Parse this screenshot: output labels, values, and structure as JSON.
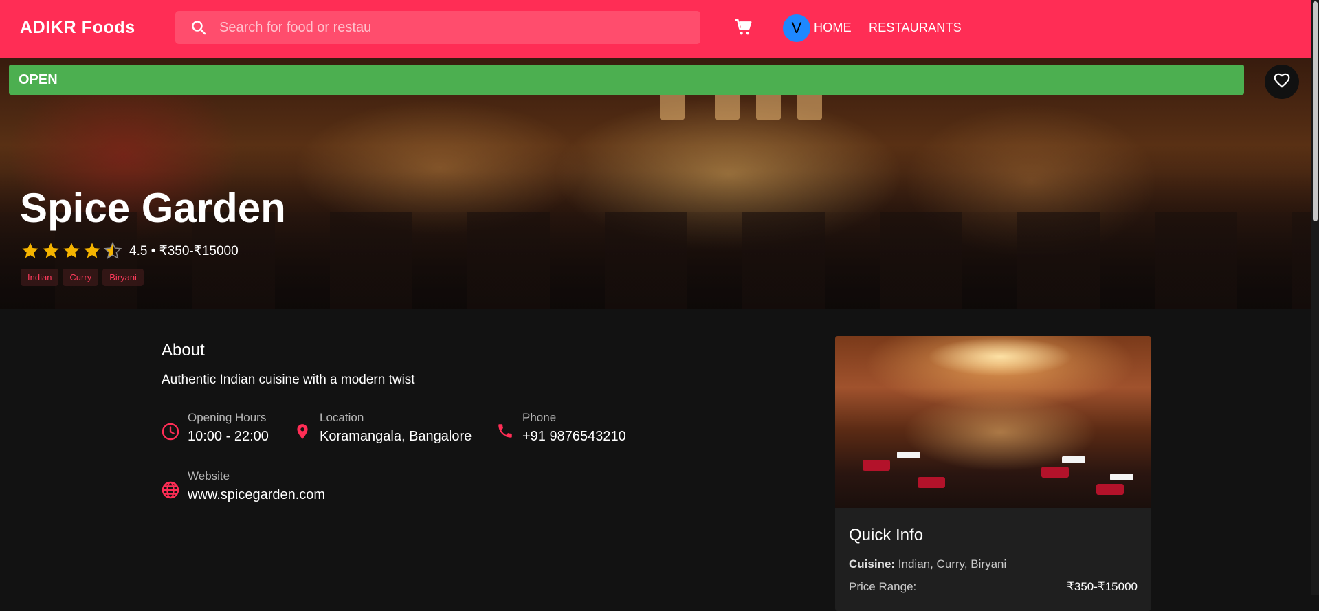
{
  "header": {
    "brand": "ADIKR Foods",
    "search_placeholder": "Search for food or restau",
    "avatar_letter": "V",
    "nav": [
      "HOME",
      "RESTAURANTS"
    ]
  },
  "restaurant": {
    "status": "OPEN",
    "name": "Spice Garden",
    "rating": 4.5,
    "rating_line": "4.5 • ₹350-₹15000",
    "tags": [
      "Indian",
      "Curry",
      "Biryani"
    ]
  },
  "about": {
    "title": "About",
    "description": "Authentic Indian cuisine with a modern twist",
    "opening_hours": {
      "label": "Opening Hours",
      "value": "10:00 - 22:00"
    },
    "location": {
      "label": "Location",
      "value": "Koramangala, Bangalore"
    },
    "phone": {
      "label": "Phone",
      "value": "+91 9876543210"
    },
    "website": {
      "label": "Website",
      "value": "www.spicegarden.com"
    }
  },
  "quick_info": {
    "title": "Quick Info",
    "cuisine_label": "Cuisine:",
    "cuisine_value": "Indian, Curry, Biryani",
    "price_label": "Price Range:",
    "price_value": "₹350-₹15000"
  },
  "colors": {
    "brand": "#ff2d55",
    "open": "#4caf50",
    "accent_icon": "#ff2d55",
    "star": "#f5b400",
    "background": "#121212"
  },
  "icons": [
    "search-icon",
    "cart-icon",
    "heart-icon",
    "star-icon",
    "clock-icon",
    "location-pin-icon",
    "phone-icon",
    "globe-icon"
  ]
}
